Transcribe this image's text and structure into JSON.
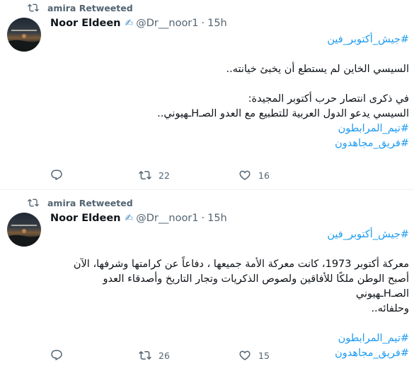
{
  "tweets": [
    {
      "retweeted_by": "amira Retweeted",
      "author_name": "Noor Eldeen",
      "author_emoji": "✍",
      "author_handle": "@Dr__noor1",
      "separator": "·",
      "time": "15h",
      "lines": [
        {
          "text": "#جيش_أكتوبر_فين",
          "tag": true
        },
        {
          "text": "",
          "tag": false
        },
        {
          "text": "السيسي الخاين لم يستطع أن يخبئ خيانته..",
          "tag": false
        },
        {
          "text": "",
          "tag": false
        },
        {
          "text": "في ذكرى انتصار حرب أكتوبر المجيدة:",
          "tag": false
        },
        {
          "text": "السيسي يدعو الدول العربية للتطبيع مع العدو الصـHـهيوني..",
          "tag": false
        },
        {
          "text": "#تيم_المرابطون",
          "tag": true
        },
        {
          "text": "#فريق_مجاهدون",
          "tag": true
        }
      ],
      "actions": {
        "reply": "",
        "retweet": "22",
        "like": "16"
      }
    },
    {
      "retweeted_by": "amira Retweeted",
      "author_name": "Noor Eldeen",
      "author_emoji": "✍",
      "author_handle": "@Dr__noor1",
      "separator": "·",
      "time": "15h",
      "lines": [
        {
          "text": "#جيش_أكتوبر_فين",
          "tag": true
        },
        {
          "text": "",
          "tag": false
        },
        {
          "text": "معركة أكتوبر 1973، كانت معركة الأمة جميعها ، دفاعاً عن كرامتها وشرفها، الآن",
          "tag": false
        },
        {
          "text": "أصبح الوطن ملكًا للأفاقين ولصوص الذكريات وتجار التاريخ وأصدقاء العدو الصـHـهيوني",
          "tag": false
        },
        {
          "text": "وحلفائه..",
          "tag": false
        },
        {
          "text": "",
          "tag": false
        },
        {
          "text": "#تيم_المرابطون",
          "tag": true
        },
        {
          "text": "#فريق_مجاهدون",
          "tag": true
        }
      ],
      "actions": {
        "reply": "",
        "retweet": "26",
        "like": "15"
      }
    }
  ],
  "colors": {
    "accent": "#1d9bf0",
    "secondary_text": "#536471",
    "divider": "#eff3f4"
  },
  "icons": {
    "retweet": "retweet-icon",
    "reply": "reply-icon",
    "like": "heart-icon"
  }
}
